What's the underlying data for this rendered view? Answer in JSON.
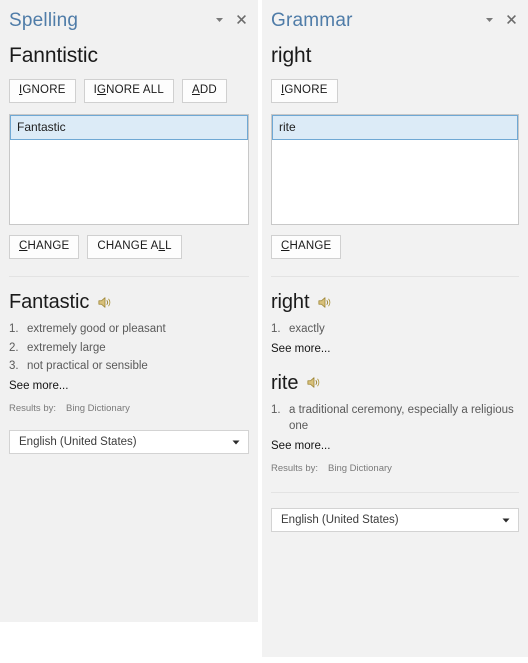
{
  "spelling": {
    "title": "Spelling",
    "collapse_icon": "chevron-down-icon",
    "close_icon": "close-icon",
    "headword": "Fanntistic",
    "buttons": [
      {
        "label": "IGNORE",
        "accel_index": 0
      },
      {
        "label": "IGNORE ALL",
        "accel_index": 1
      },
      {
        "label": "ADD",
        "accel_index": 0
      }
    ],
    "suggestions": [
      {
        "text": "Fantastic",
        "selected": true
      }
    ],
    "change_buttons": [
      {
        "label": "CHANGE",
        "accel_index": 0
      },
      {
        "label": "CHANGE ALL",
        "accel_index": 8
      }
    ],
    "definitions": [
      {
        "word": "Fantastic",
        "speaker_icon": "speaker-icon",
        "senses": [
          {
            "num": "1.",
            "text": "extremely good or pleasant"
          },
          {
            "num": "2.",
            "text": "extremely large"
          },
          {
            "num": "3.",
            "text": "not practical or sensible"
          }
        ],
        "see_more": "See more..."
      }
    ],
    "results_by_label": "Results by:",
    "results_by_source": "Bing Dictionary",
    "language": "English (United States)",
    "language_caret_icon": "caret-down-icon"
  },
  "grammar": {
    "title": "Grammar",
    "collapse_icon": "chevron-down-icon",
    "close_icon": "close-icon",
    "headword": "right",
    "buttons": [
      {
        "label": "IGNORE",
        "accel_index": 0
      }
    ],
    "suggestions": [
      {
        "text": "rite",
        "selected": true
      }
    ],
    "change_buttons": [
      {
        "label": "CHANGE",
        "accel_index": 0
      }
    ],
    "definitions": [
      {
        "word": "right",
        "speaker_icon": "speaker-icon",
        "senses": [
          {
            "num": "1.",
            "text": "exactly"
          }
        ],
        "see_more": "See more..."
      },
      {
        "word": "rite",
        "speaker_icon": "speaker-icon",
        "senses": [
          {
            "num": "1.",
            "text": "a traditional ceremony, especially a religious one"
          }
        ],
        "see_more": "See more..."
      }
    ],
    "results_by_label": "Results by:",
    "results_by_source": "Bing Dictionary",
    "language": "English (United States)",
    "language_caret_icon": "caret-down-icon"
  },
  "colors": {
    "panel_title": "#4f7ca8",
    "panel_background": "#f1f1f1",
    "selection_background": "#dcebf7",
    "selection_border": "#6fa8d4",
    "speaker_icon": "#c9a227"
  }
}
